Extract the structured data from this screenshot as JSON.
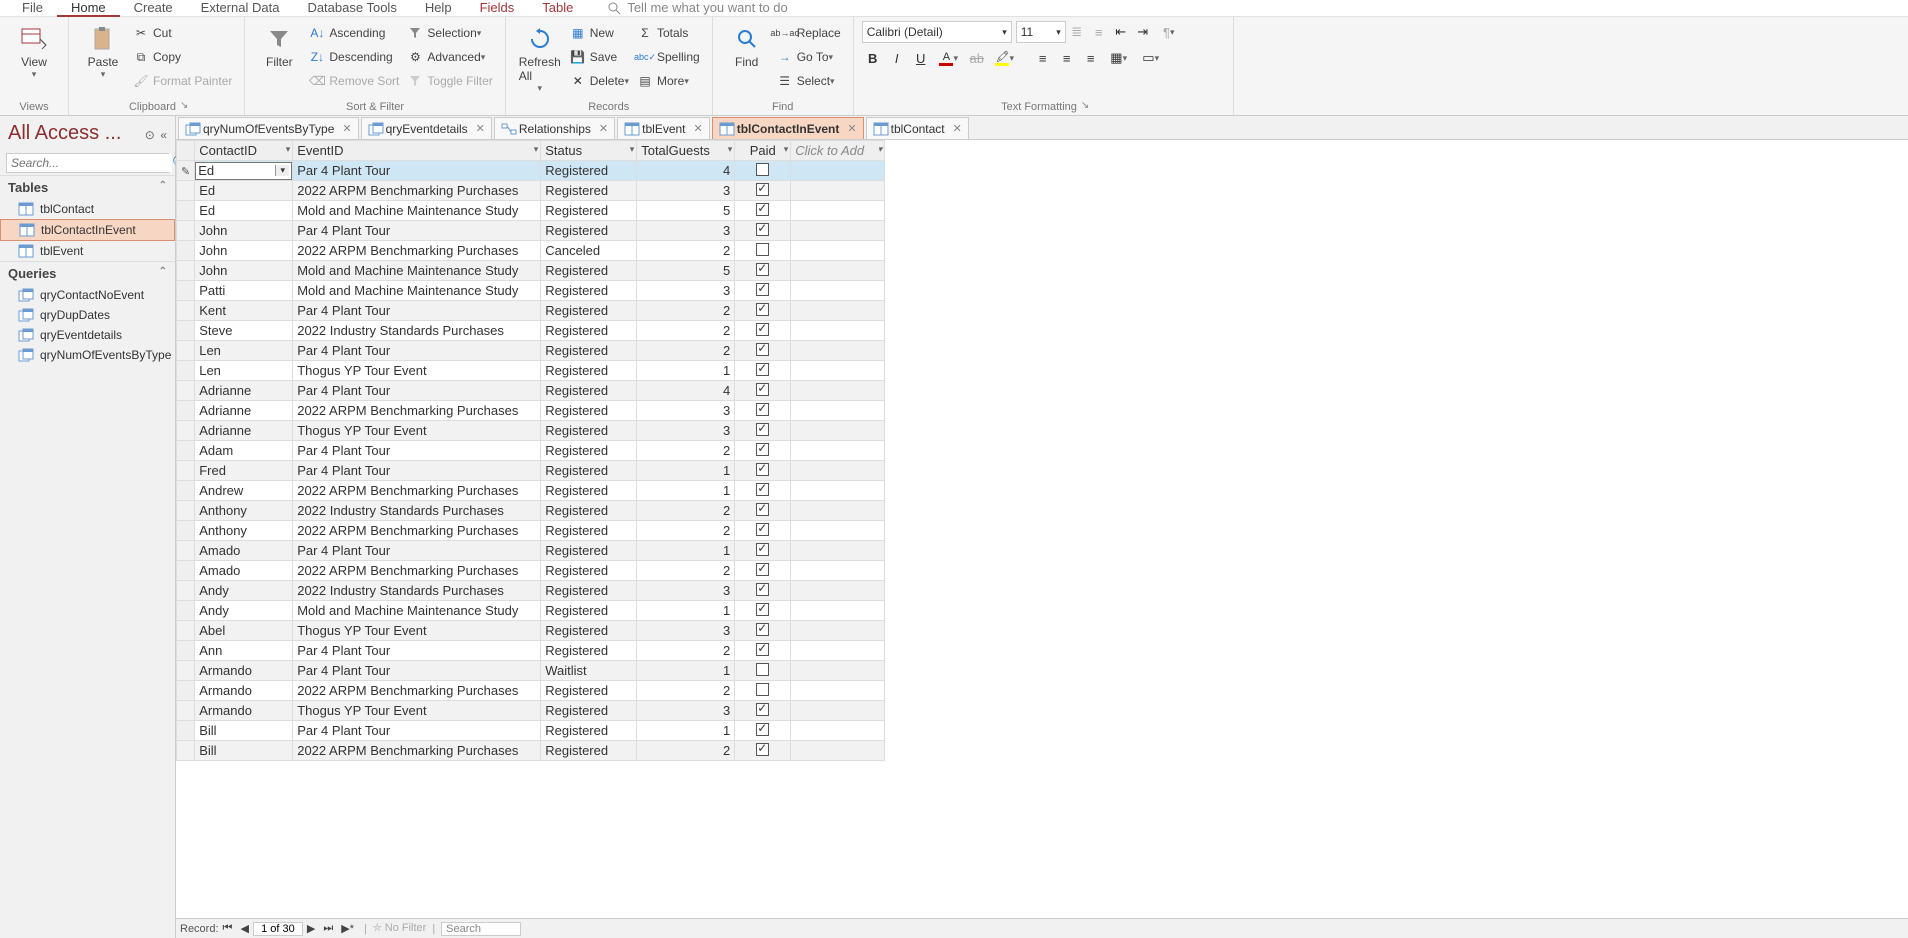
{
  "menu": {
    "items": [
      "File",
      "Home",
      "Create",
      "External Data",
      "Database Tools",
      "Help",
      "Fields",
      "Table"
    ],
    "active": "Home",
    "toolStart": 6,
    "search": "Tell me what you want to do"
  },
  "ribbon": {
    "views": {
      "label": "Views",
      "btn": "View"
    },
    "clipboard": {
      "label": "Clipboard",
      "paste": "Paste",
      "cut": "Cut",
      "copy": "Copy",
      "fmt": "Format Painter"
    },
    "sortfilter": {
      "label": "Sort & Filter",
      "filter": "Filter",
      "asc": "Ascending",
      "desc": "Descending",
      "remove": "Remove Sort",
      "selection": "Selection",
      "advanced": "Advanced",
      "toggle": "Toggle Filter"
    },
    "records": {
      "label": "Records",
      "refresh": "Refresh\nAll",
      "new": "New",
      "save": "Save",
      "delete": "Delete",
      "totals": "Totals",
      "spelling": "Spelling",
      "more": "More"
    },
    "find": {
      "label": "Find",
      "find": "Find",
      "replace": "Replace",
      "goto": "Go To",
      "select": "Select"
    },
    "text": {
      "label": "Text Formatting",
      "font": "Calibri (Detail)",
      "size": "11"
    }
  },
  "nav": {
    "title": "All Access ...",
    "search": "Search...",
    "sections": [
      {
        "label": "Tables",
        "items": [
          {
            "label": "tblContact",
            "type": "table"
          },
          {
            "label": "tblContactInEvent",
            "type": "table",
            "sel": true
          },
          {
            "label": "tblEvent",
            "type": "table"
          }
        ]
      },
      {
        "label": "Queries",
        "items": [
          {
            "label": "qryContactNoEvent",
            "type": "query"
          },
          {
            "label": "qryDupDates",
            "type": "query"
          },
          {
            "label": "qryEventdetails",
            "type": "query"
          },
          {
            "label": "qryNumOfEventsByType",
            "type": "query"
          }
        ]
      }
    ]
  },
  "tabs": [
    {
      "label": "qryNumOfEventsByType",
      "type": "query"
    },
    {
      "label": "qryEventdetails",
      "type": "query"
    },
    {
      "label": "Relationships",
      "type": "rel"
    },
    {
      "label": "tblEvent",
      "type": "table"
    },
    {
      "label": "tblContactInEvent",
      "type": "table",
      "active": true
    },
    {
      "label": "tblContact",
      "type": "table"
    }
  ],
  "columns": [
    "ContactID",
    "EventID",
    "Status",
    "TotalGuests",
    "Paid",
    "Click to Add"
  ],
  "rows": [
    {
      "c": "Ed",
      "e": "Par 4 Plant Tour",
      "s": "Registered",
      "g": 4,
      "p": false,
      "editing": true
    },
    {
      "c": "Ed",
      "e": "2022 ARPM Benchmarking Purchases",
      "s": "Registered",
      "g": 3,
      "p": true
    },
    {
      "c": "Ed",
      "e": "Mold and Machine Maintenance Study",
      "s": "Registered",
      "g": 5,
      "p": true
    },
    {
      "c": "John",
      "e": "Par 4 Plant Tour",
      "s": "Registered",
      "g": 3,
      "p": true
    },
    {
      "c": "John",
      "e": "2022 ARPM Benchmarking Purchases",
      "s": "Canceled",
      "g": 2,
      "p": false
    },
    {
      "c": "John",
      "e": "Mold and Machine Maintenance Study",
      "s": "Registered",
      "g": 5,
      "p": true
    },
    {
      "c": "Patti",
      "e": "Mold and Machine Maintenance Study",
      "s": "Registered",
      "g": 3,
      "p": true
    },
    {
      "c": "Kent",
      "e": "Par 4 Plant Tour",
      "s": "Registered",
      "g": 2,
      "p": true
    },
    {
      "c": "Steve",
      "e": "2022 Industry Standards Purchases",
      "s": "Registered",
      "g": 2,
      "p": true
    },
    {
      "c": "Len",
      "e": "Par 4 Plant Tour",
      "s": "Registered",
      "g": 2,
      "p": true
    },
    {
      "c": "Len",
      "e": "Thogus YP Tour Event",
      "s": "Registered",
      "g": 1,
      "p": true
    },
    {
      "c": "Adrianne",
      "e": "Par 4 Plant Tour",
      "s": "Registered",
      "g": 4,
      "p": true
    },
    {
      "c": "Adrianne",
      "e": "2022 ARPM Benchmarking Purchases",
      "s": "Registered",
      "g": 3,
      "p": true
    },
    {
      "c": "Adrianne",
      "e": "Thogus YP Tour Event",
      "s": "Registered",
      "g": 3,
      "p": true
    },
    {
      "c": "Adam",
      "e": "Par 4 Plant Tour",
      "s": "Registered",
      "g": 2,
      "p": true
    },
    {
      "c": "Fred",
      "e": "Par 4 Plant Tour",
      "s": "Registered",
      "g": 1,
      "p": true
    },
    {
      "c": "Andrew",
      "e": "2022 ARPM Benchmarking Purchases",
      "s": "Registered",
      "g": 1,
      "p": true
    },
    {
      "c": "Anthony",
      "e": "2022 Industry Standards Purchases",
      "s": "Registered",
      "g": 2,
      "p": true
    },
    {
      "c": "Anthony",
      "e": "2022 ARPM Benchmarking Purchases",
      "s": "Registered",
      "g": 2,
      "p": true
    },
    {
      "c": "Amado",
      "e": "Par 4 Plant Tour",
      "s": "Registered",
      "g": 1,
      "p": true
    },
    {
      "c": "Amado",
      "e": "2022 ARPM Benchmarking Purchases",
      "s": "Registered",
      "g": 2,
      "p": true
    },
    {
      "c": "Andy",
      "e": "2022 Industry Standards Purchases",
      "s": "Registered",
      "g": 3,
      "p": true
    },
    {
      "c": "Andy",
      "e": "Mold and Machine Maintenance Study",
      "s": "Registered",
      "g": 1,
      "p": true
    },
    {
      "c": "Abel",
      "e": "Thogus YP Tour Event",
      "s": "Registered",
      "g": 3,
      "p": true
    },
    {
      "c": "Ann",
      "e": "Par 4 Plant Tour",
      "s": "Registered",
      "g": 2,
      "p": true
    },
    {
      "c": "Armando",
      "e": "Par 4 Plant Tour",
      "s": "Waitlist",
      "g": 1,
      "p": false
    },
    {
      "c": "Armando",
      "e": "2022 ARPM Benchmarking Purchases",
      "s": "Registered",
      "g": 2,
      "p": false
    },
    {
      "c": "Armando",
      "e": "Thogus YP Tour Event",
      "s": "Registered",
      "g": 3,
      "p": true
    },
    {
      "c": "Bill",
      "e": "Par 4 Plant Tour",
      "s": "Registered",
      "g": 1,
      "p": true
    },
    {
      "c": "Bill",
      "e": "2022 ARPM Benchmarking Purchases",
      "s": "Registered",
      "g": 2,
      "p": true
    }
  ],
  "recnav": {
    "label": "Record:",
    "pos": "1 of 30",
    "filter": "No Filter",
    "search": "Search"
  }
}
